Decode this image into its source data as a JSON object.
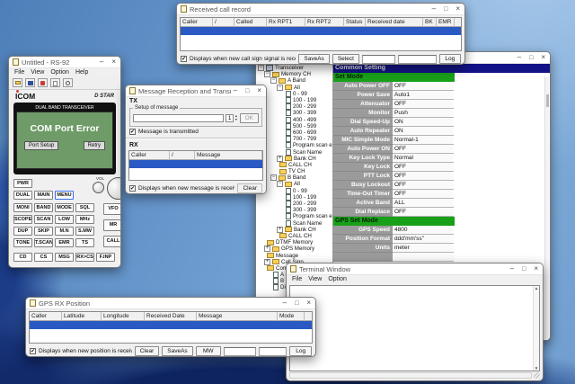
{
  "colors": {
    "selection_blue": "#2b59c3",
    "header_navy": "#131388",
    "section_green": "#19a019",
    "lcd_green": "#6e9b67",
    "icom_red": "#e03c31"
  },
  "call_record_window": {
    "title": "Received call record",
    "columns": [
      "Caller",
      "/",
      "Called",
      "Rx RPT1",
      "Rx RPT2",
      "Status",
      "Received date",
      "BK",
      "EMR"
    ],
    "checkbox_label": "Displays when new call sign signal is received.",
    "saveas_label": "SaveAs",
    "select_label": "Select",
    "log_label": "Log"
  },
  "rs92_window": {
    "title": "Untitled - RS-92",
    "menu": [
      "File",
      "View",
      "Option",
      "Help"
    ],
    "brand_left": "ICOM",
    "brand_right": "D STAR",
    "display_header": "DUAL BAND TRANSCEIVER",
    "error_text": "COM Port Error",
    "port_setup_label": "Port Setup",
    "retry_label": "Retry",
    "vol_label": "VOL",
    "keys": {
      "row1": [
        "PWR"
      ],
      "row2": [
        "DUAL",
        "MAIN",
        "MENU"
      ],
      "grid1": [
        "MONI",
        "BAND",
        "MODE",
        "SQL"
      ],
      "grid2": [
        "SCOPE",
        "SCAN",
        "LOW",
        "MHz"
      ],
      "grid3": [
        "DUP",
        "SKIP",
        "M.N",
        "S.MW"
      ],
      "grid4": [
        "TONE",
        "T.SCAN",
        "EMR",
        "TS"
      ],
      "side": [
        "VFO",
        "MR",
        "CALL"
      ],
      "bottom": [
        "CD",
        "CS",
        "MSG",
        "RX>CS",
        "F.INP"
      ]
    }
  },
  "msg_window": {
    "title": "Message Reception and Transmission",
    "tx_label": "TX",
    "tx_group_label": "Setup of message",
    "spinner_value": "1",
    "ok_label": "OK",
    "tx_checkbox_label": "Message is transmitted",
    "rx_label": "RX",
    "columns": [
      "Caller",
      "/",
      "Message"
    ],
    "bottom_checkbox_label": "Displays when new message is received.",
    "clear_label": "Clear"
  },
  "editor_window": {
    "title": "",
    "header": "Common Setting",
    "tree": [
      {
        "d": 0,
        "t": "root",
        "e": "m",
        "label": "Transceiver"
      },
      {
        "d": 1,
        "t": "fo",
        "e": "m",
        "label": "Memory CH"
      },
      {
        "d": 2,
        "t": "fo",
        "e": "m",
        "label": "A Band"
      },
      {
        "d": 3,
        "t": "fo",
        "e": "m",
        "label": "All"
      },
      {
        "d": 4,
        "t": "doc",
        "e": "n",
        "label": "0 - 99"
      },
      {
        "d": 4,
        "t": "doc",
        "e": "n",
        "label": "100 - 199"
      },
      {
        "d": 4,
        "t": "doc",
        "e": "n",
        "label": "200 - 299"
      },
      {
        "d": 4,
        "t": "doc",
        "e": "n",
        "label": "300 - 399"
      },
      {
        "d": 4,
        "t": "doc",
        "e": "n",
        "label": "400 - 499"
      },
      {
        "d": 4,
        "t": "doc",
        "e": "n",
        "label": "500 - 599"
      },
      {
        "d": 4,
        "t": "doc",
        "e": "n",
        "label": "600 - 699"
      },
      {
        "d": 4,
        "t": "doc",
        "e": "n",
        "label": "700 - 799"
      },
      {
        "d": 4,
        "t": "doc",
        "e": "n",
        "label": "Program scan e"
      },
      {
        "d": 4,
        "t": "doc",
        "e": "n",
        "label": "Scan Name"
      },
      {
        "d": 3,
        "t": "fc",
        "e": "p",
        "label": "Bank CH"
      },
      {
        "d": 3,
        "t": "fc",
        "e": "n",
        "label": "CALL CH"
      },
      {
        "d": 3,
        "t": "fc",
        "e": "n",
        "label": "TV CH"
      },
      {
        "d": 2,
        "t": "fo",
        "e": "m",
        "label": "B Band"
      },
      {
        "d": 3,
        "t": "fo",
        "e": "m",
        "label": "All"
      },
      {
        "d": 4,
        "t": "doc",
        "e": "n",
        "label": "0 - 99"
      },
      {
        "d": 4,
        "t": "doc",
        "e": "n",
        "label": "100 - 199"
      },
      {
        "d": 4,
        "t": "doc",
        "e": "n",
        "label": "200 - 299"
      },
      {
        "d": 4,
        "t": "doc",
        "e": "n",
        "label": "300 - 399"
      },
      {
        "d": 4,
        "t": "doc",
        "e": "n",
        "label": "Program scan e"
      },
      {
        "d": 4,
        "t": "doc",
        "e": "n",
        "label": "Scan Name"
      },
      {
        "d": 3,
        "t": "fc",
        "e": "p",
        "label": "Bank CH"
      },
      {
        "d": 3,
        "t": "fc",
        "e": "n",
        "label": "CALL CH"
      },
      {
        "d": 1,
        "t": "fc",
        "e": "n",
        "label": "DTMF Memory"
      },
      {
        "d": 1,
        "t": "fc",
        "e": "p",
        "label": "GPS Memory"
      },
      {
        "d": 1,
        "t": "fc",
        "e": "n",
        "label": "Message"
      },
      {
        "d": 1,
        "t": "fc",
        "e": "p",
        "label": "Call Sign"
      },
      {
        "d": 1,
        "t": "fc",
        "e": "n",
        "label": "Common Setting"
      },
      {
        "d": 2,
        "t": "doc",
        "e": "n",
        "label": "A Band"
      },
      {
        "d": 2,
        "t": "doc",
        "e": "n",
        "label": "B Band"
      },
      {
        "d": 2,
        "t": "doc",
        "e": "n",
        "label": "Digital"
      }
    ],
    "sections": [
      {
        "title": "Set Mode",
        "rows": [
          [
            "Auto Power OFF",
            "OFF"
          ],
          [
            "Power Save",
            "Auto1"
          ],
          [
            "Attenuator",
            "OFF"
          ],
          [
            "Monitor",
            "Push"
          ],
          [
            "Dial Speed-Up",
            "ON"
          ],
          [
            "Auto Repeater",
            "ON"
          ],
          [
            "MIC Simple Mode",
            "Normal-1"
          ],
          [
            "Auto Power ON",
            "OFF"
          ],
          [
            "Key Lock Type",
            "Normal"
          ],
          [
            "Key Lock",
            "OFF"
          ],
          [
            "PTT Lock",
            "OFF"
          ],
          [
            "Busy Lockout",
            "OFF"
          ],
          [
            "Time-Out Timer",
            "OFF"
          ],
          [
            "Active Band",
            "ALL"
          ],
          [
            "Dial Replace",
            "OFF"
          ]
        ]
      },
      {
        "title": "GPS Set Mode",
        "rows": [
          [
            "GPS Speed",
            "4800"
          ],
          [
            "Position Format",
            "ddd'mm'ss\""
          ],
          [
            "Units",
            "meter"
          ]
        ]
      }
    ]
  },
  "terminal_window": {
    "title": "Terminal Window",
    "menu": [
      "File",
      "View",
      "Option"
    ]
  },
  "gps_window": {
    "title": "GPS RX Position",
    "columns": [
      "Caller",
      "Latitude",
      "Longitude",
      "Received Date",
      "Message",
      "Mode"
    ],
    "checkbox_label": "Displays when new position is received.",
    "clear_label": "Clear",
    "saveas_label": "SaveAs",
    "mw_label": "MW",
    "log_label": "Log"
  }
}
